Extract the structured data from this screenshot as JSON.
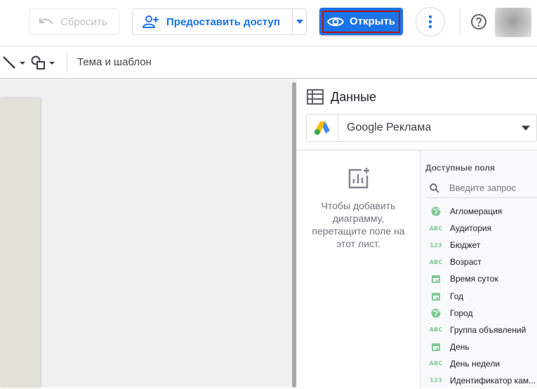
{
  "header": {
    "reset_label": "Сбросить",
    "share_label": "Предоставить доступ",
    "open_label": "Открыть"
  },
  "toolbar": {
    "theme_label": "Тема и шаблон"
  },
  "panel": {
    "title": "Данные",
    "datasource": "Google Реклама",
    "empty_hint": "Чтобы добавить диаграмму, перетащите поле на этот лист.",
    "fields_header": "Доступные поля",
    "search_placeholder": "Введите запрос",
    "fields": [
      {
        "label": "Агломерация",
        "type": "geo"
      },
      {
        "label": "Аудитория",
        "type": "text"
      },
      {
        "label": "Бюджет",
        "type": "number"
      },
      {
        "label": "Возраст",
        "type": "text"
      },
      {
        "label": "Время суток",
        "type": "date"
      },
      {
        "label": "Год",
        "type": "date"
      },
      {
        "label": "Город",
        "type": "geo"
      },
      {
        "label": "Группа объявлений",
        "type": "text"
      },
      {
        "label": "День",
        "type": "date"
      },
      {
        "label": "День недели",
        "type": "text"
      },
      {
        "label": "Идентификатор кам...",
        "type": "number"
      }
    ]
  },
  "colors": {
    "accent": "#1a73e8",
    "focus_outline": "#b31412",
    "field_icon": "#81c995"
  }
}
